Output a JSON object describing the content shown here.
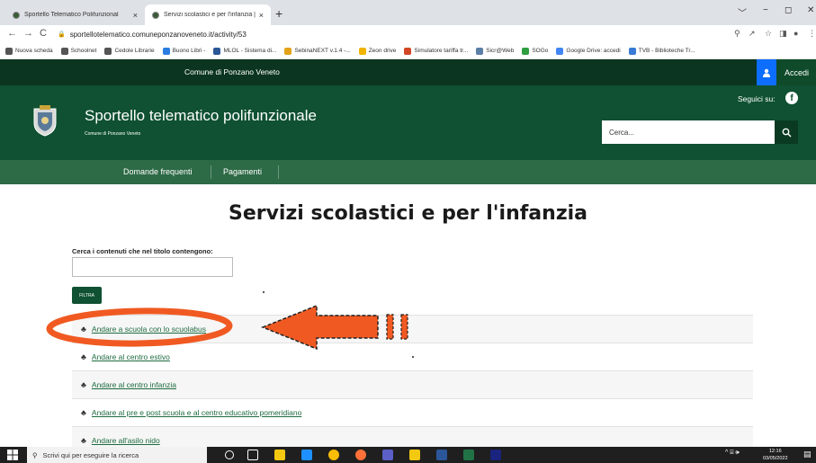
{
  "browser": {
    "tabs": [
      {
        "title": "Sportello Telematico Polifunzional",
        "close": "×"
      },
      {
        "title": "Servizi scolastici e per l'infanzia |",
        "close": "×"
      }
    ],
    "new_tab": "+",
    "window_controls": [
      "﹀",
      "−",
      "◻",
      "✕"
    ],
    "nav": {
      "back": "←",
      "forward": "→",
      "reload": "C"
    },
    "url": "sportellotelematico.comuneponzanoveneto.it/activity/53",
    "toolbar_icons": [
      "⚲",
      "↗",
      "☆",
      "◨",
      "●",
      "⋮"
    ],
    "bookmarks": [
      {
        "label": "Nuova scheda",
        "color": "#555555"
      },
      {
        "label": "Schoolnet",
        "color": "#555555"
      },
      {
        "label": "Cedole Librarie",
        "color": "#555555"
      },
      {
        "label": "Buono Libri -",
        "color": "#2a7de1"
      },
      {
        "label": "MLOL - Sistema di...",
        "color": "#2b5797"
      },
      {
        "label": "SebinaNEXT v.1.4 -...",
        "color": "#e3a21a"
      },
      {
        "label": "Zeon drive",
        "color": "#f0b400"
      },
      {
        "label": "Simulatore tariffa tr...",
        "color": "#d24726"
      },
      {
        "label": "Sicr@Web",
        "color": "#5b7fa6"
      },
      {
        "label": "SOGo",
        "color": "#2e9e3e"
      },
      {
        "label": "Google Drive: accedi",
        "color": "#4285f4"
      },
      {
        "label": "TVB - Biblioteche Tr...",
        "color": "#3a7bd5"
      }
    ]
  },
  "site": {
    "municipality": "Comune di Ponzano Veneto",
    "login_label": "Accedi",
    "title": "Sportello telematico polifunzionale",
    "subtitle": "Comune di Ponzano Veneto",
    "follow_label": "Seguici su:",
    "facebook": "f",
    "search_placeholder": "Cerca...",
    "nav": [
      "Domande frequenti",
      "Pagamenti"
    ]
  },
  "main": {
    "heading": "Servizi scolastici e per l'infanzia",
    "filter_label": "Cerca i contenuti che nel titolo contengono:",
    "filter_value": "",
    "filter_button": "FILTRA",
    "items": [
      "Andare a scuola con lo scuolabus",
      "Andare al centro estivo",
      "Andare al centro infanzia",
      "Andare al pre e post scuola e al centro educativo pomeridiano",
      "Andare all'asilo nido"
    ],
    "item_icon": "group-icon"
  },
  "annotation_color": "#f05a22",
  "taskbar": {
    "search_placeholder": "Scrivi qui per eseguire la ricerca",
    "time": "12:16",
    "date": "03/05/2022",
    "tray": "^ ⌸ 🕪"
  }
}
